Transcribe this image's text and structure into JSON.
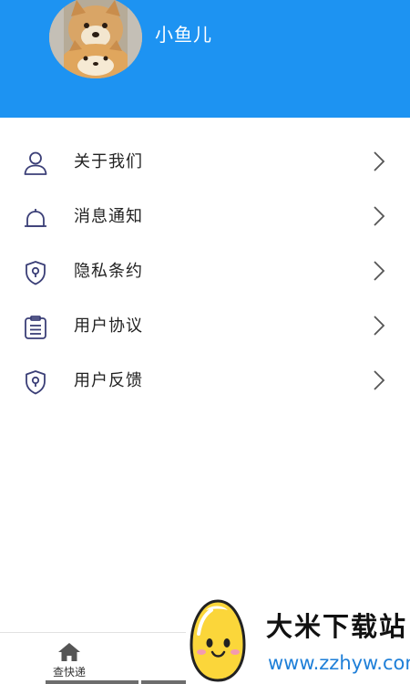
{
  "header": {
    "username": "小鱼儿",
    "background_color": "#1d93f2"
  },
  "menu": {
    "items": [
      {
        "label": "关于我们",
        "icon": "user-icon"
      },
      {
        "label": "消息通知",
        "icon": "bell-icon"
      },
      {
        "label": "隐私条约",
        "icon": "shield-icon"
      },
      {
        "label": "用户协议",
        "icon": "clipboard-icon"
      },
      {
        "label": "用户反馈",
        "icon": "shield-icon"
      }
    ],
    "chevron_icon": "chevron-right-icon"
  },
  "bottom_nav": {
    "tabs": [
      {
        "label": "查快递",
        "icon": "home-icon"
      }
    ]
  },
  "watermark": {
    "title": "大米下载站",
    "url": "www.zzhyw.com"
  }
}
